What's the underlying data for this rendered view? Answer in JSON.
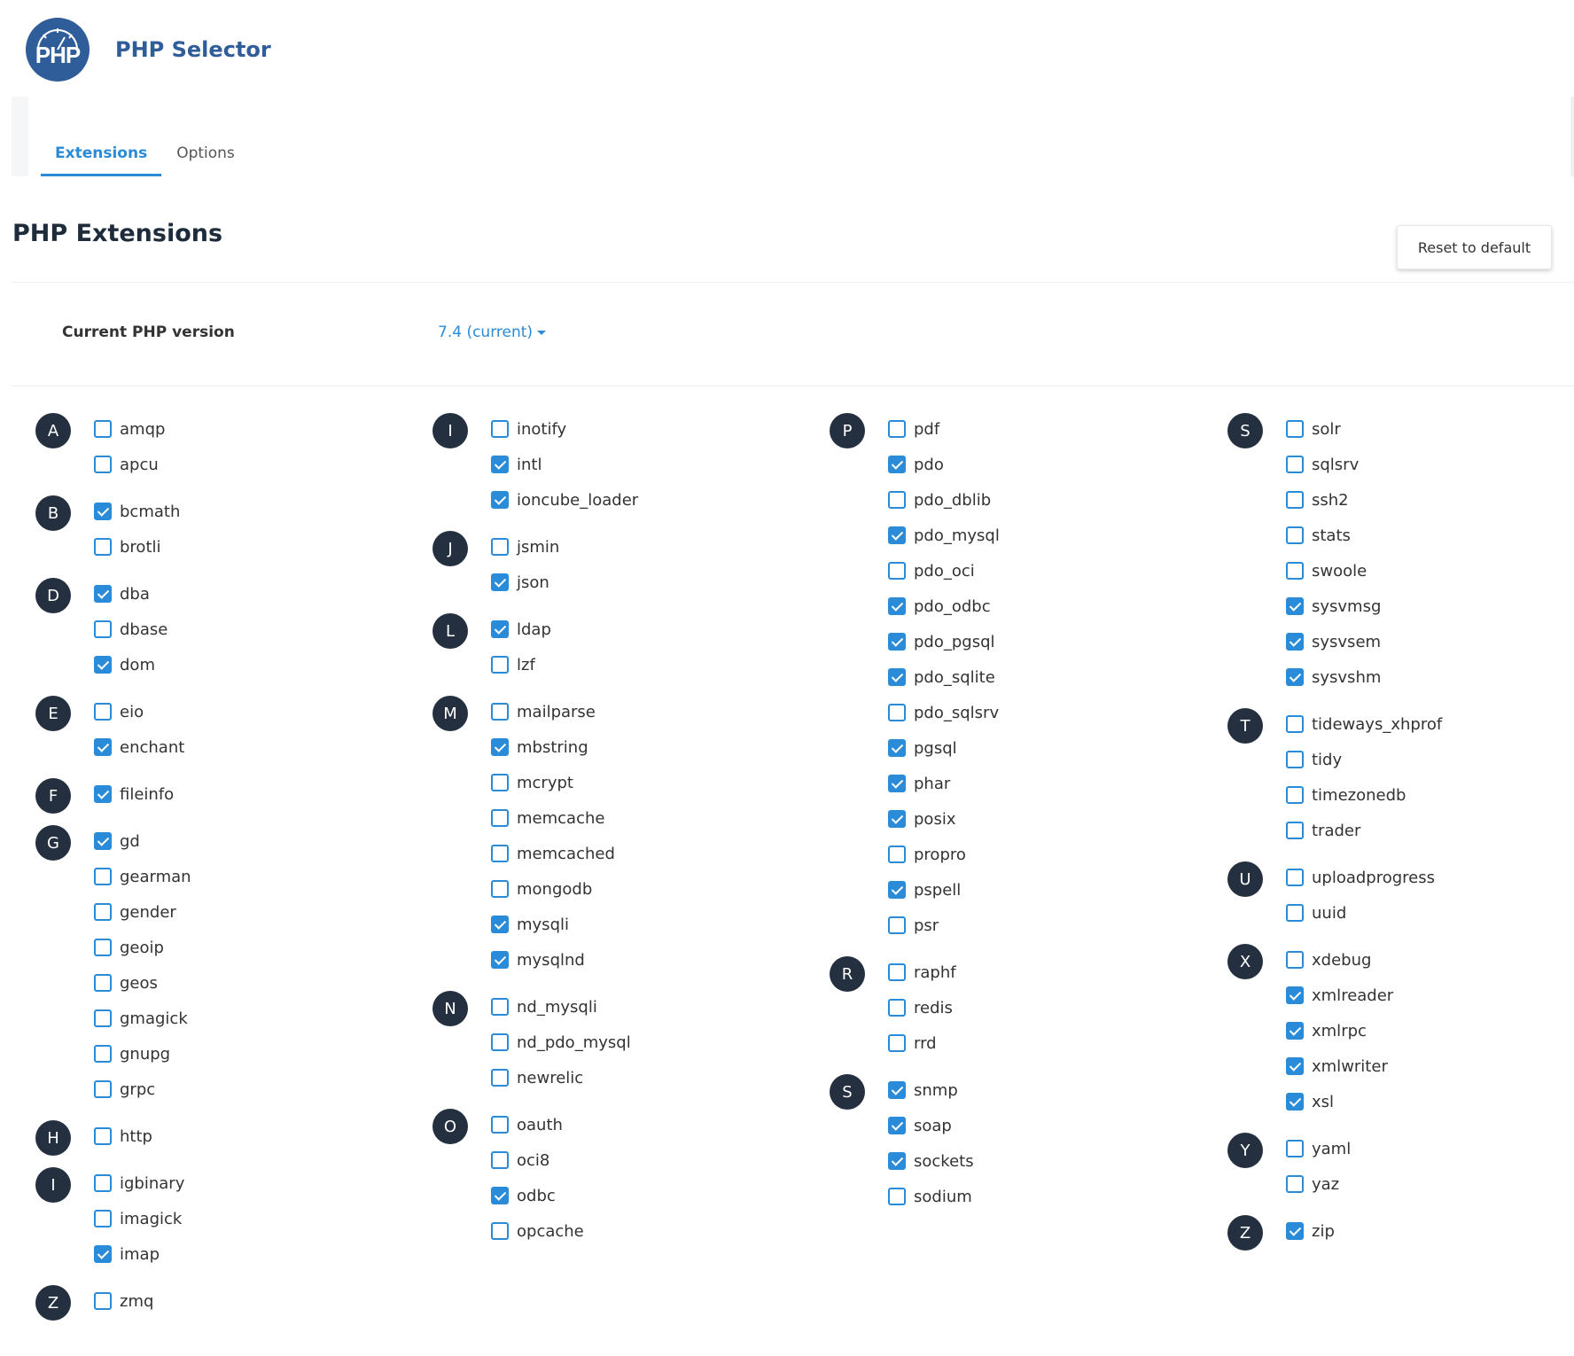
{
  "header": {
    "logo_text": "PHP",
    "title": "PHP Selector"
  },
  "tabs": [
    {
      "label": "Extensions",
      "active": true
    },
    {
      "label": "Options",
      "active": false
    }
  ],
  "section_title": "PHP Extensions",
  "reset_label": "Reset to default",
  "version": {
    "label": "Current PHP version",
    "value": "7.4 (current)"
  },
  "colors": {
    "brand": "#2f5d99",
    "accent": "#2a8bd8",
    "badge": "#24303f"
  },
  "columns": [
    {
      "groups": [
        {
          "letter": "A",
          "items": [
            {
              "name": "amqp",
              "checked": false
            },
            {
              "name": "apcu",
              "checked": false
            }
          ]
        },
        {
          "letter": "B",
          "items": [
            {
              "name": "bcmath",
              "checked": true
            },
            {
              "name": "brotli",
              "checked": false
            }
          ]
        },
        {
          "letter": "D",
          "items": [
            {
              "name": "dba",
              "checked": true
            },
            {
              "name": "dbase",
              "checked": false
            },
            {
              "name": "dom",
              "checked": true
            }
          ]
        },
        {
          "letter": "E",
          "items": [
            {
              "name": "eio",
              "checked": false
            },
            {
              "name": "enchant",
              "checked": true
            }
          ]
        },
        {
          "letter": "F",
          "items": [
            {
              "name": "fileinfo",
              "checked": true
            }
          ]
        },
        {
          "letter": "G",
          "items": [
            {
              "name": "gd",
              "checked": true
            },
            {
              "name": "gearman",
              "checked": false
            },
            {
              "name": "gender",
              "checked": false
            },
            {
              "name": "geoip",
              "checked": false
            },
            {
              "name": "geos",
              "checked": false
            },
            {
              "name": "gmagick",
              "checked": false
            },
            {
              "name": "gnupg",
              "checked": false
            },
            {
              "name": "grpc",
              "checked": false
            }
          ]
        },
        {
          "letter": "H",
          "items": [
            {
              "name": "http",
              "checked": false
            }
          ]
        },
        {
          "letter": "I",
          "items": [
            {
              "name": "igbinary",
              "checked": false
            },
            {
              "name": "imagick",
              "checked": false
            },
            {
              "name": "imap",
              "checked": true
            }
          ]
        },
        {
          "letter": "Z",
          "items": [
            {
              "name": "zmq",
              "checked": false
            }
          ]
        }
      ]
    },
    {
      "groups": [
        {
          "letter": "I",
          "items": [
            {
              "name": "inotify",
              "checked": false
            },
            {
              "name": "intl",
              "checked": true
            },
            {
              "name": "ioncube_loader",
              "checked": true
            }
          ]
        },
        {
          "letter": "J",
          "items": [
            {
              "name": "jsmin",
              "checked": false
            },
            {
              "name": "json",
              "checked": true
            }
          ]
        },
        {
          "letter": "L",
          "items": [
            {
              "name": "ldap",
              "checked": true
            },
            {
              "name": "lzf",
              "checked": false
            }
          ]
        },
        {
          "letter": "M",
          "items": [
            {
              "name": "mailparse",
              "checked": false
            },
            {
              "name": "mbstring",
              "checked": true
            },
            {
              "name": "mcrypt",
              "checked": false
            },
            {
              "name": "memcache",
              "checked": false
            },
            {
              "name": "memcached",
              "checked": false
            },
            {
              "name": "mongodb",
              "checked": false
            },
            {
              "name": "mysqli",
              "checked": true
            },
            {
              "name": "mysqlnd",
              "checked": true
            }
          ]
        },
        {
          "letter": "N",
          "items": [
            {
              "name": "nd_mysqli",
              "checked": false
            },
            {
              "name": "nd_pdo_mysql",
              "checked": false
            },
            {
              "name": "newrelic",
              "checked": false
            }
          ]
        },
        {
          "letter": "O",
          "items": [
            {
              "name": "oauth",
              "checked": false
            },
            {
              "name": "oci8",
              "checked": false
            },
            {
              "name": "odbc",
              "checked": true
            },
            {
              "name": "opcache",
              "checked": false
            }
          ]
        }
      ]
    },
    {
      "groups": [
        {
          "letter": "P",
          "items": [
            {
              "name": "pdf",
              "checked": false
            },
            {
              "name": "pdo",
              "checked": true
            },
            {
              "name": "pdo_dblib",
              "checked": false
            },
            {
              "name": "pdo_mysql",
              "checked": true
            },
            {
              "name": "pdo_oci",
              "checked": false
            },
            {
              "name": "pdo_odbc",
              "checked": true
            },
            {
              "name": "pdo_pgsql",
              "checked": true
            },
            {
              "name": "pdo_sqlite",
              "checked": true
            },
            {
              "name": "pdo_sqlsrv",
              "checked": false
            },
            {
              "name": "pgsql",
              "checked": true
            },
            {
              "name": "phar",
              "checked": true
            },
            {
              "name": "posix",
              "checked": true
            },
            {
              "name": "propro",
              "checked": false
            },
            {
              "name": "pspell",
              "checked": true
            },
            {
              "name": "psr",
              "checked": false
            }
          ]
        },
        {
          "letter": "R",
          "items": [
            {
              "name": "raphf",
              "checked": false
            },
            {
              "name": "redis",
              "checked": false
            },
            {
              "name": "rrd",
              "checked": false
            }
          ]
        },
        {
          "letter": "S",
          "items": [
            {
              "name": "snmp",
              "checked": true
            },
            {
              "name": "soap",
              "checked": true
            },
            {
              "name": "sockets",
              "checked": true
            },
            {
              "name": "sodium",
              "checked": false
            }
          ]
        }
      ]
    },
    {
      "groups": [
        {
          "letter": "S",
          "items": [
            {
              "name": "solr",
              "checked": false
            },
            {
              "name": "sqlsrv",
              "checked": false
            },
            {
              "name": "ssh2",
              "checked": false
            },
            {
              "name": "stats",
              "checked": false
            },
            {
              "name": "swoole",
              "checked": false
            },
            {
              "name": "sysvmsg",
              "checked": true
            },
            {
              "name": "sysvsem",
              "checked": true
            },
            {
              "name": "sysvshm",
              "checked": true
            }
          ]
        },
        {
          "letter": "T",
          "items": [
            {
              "name": "tideways_xhprof",
              "checked": false
            },
            {
              "name": "tidy",
              "checked": false
            },
            {
              "name": "timezonedb",
              "checked": false
            },
            {
              "name": "trader",
              "checked": false
            }
          ]
        },
        {
          "letter": "U",
          "items": [
            {
              "name": "uploadprogress",
              "checked": false
            },
            {
              "name": "uuid",
              "checked": false
            }
          ]
        },
        {
          "letter": "X",
          "items": [
            {
              "name": "xdebug",
              "checked": false
            },
            {
              "name": "xmlreader",
              "checked": true
            },
            {
              "name": "xmlrpc",
              "checked": true
            },
            {
              "name": "xmlwriter",
              "checked": true
            },
            {
              "name": "xsl",
              "checked": true
            }
          ]
        },
        {
          "letter": "Y",
          "items": [
            {
              "name": "yaml",
              "checked": false
            },
            {
              "name": "yaz",
              "checked": false
            }
          ]
        },
        {
          "letter": "Z",
          "items": [
            {
              "name": "zip",
              "checked": true
            }
          ]
        }
      ]
    }
  ]
}
